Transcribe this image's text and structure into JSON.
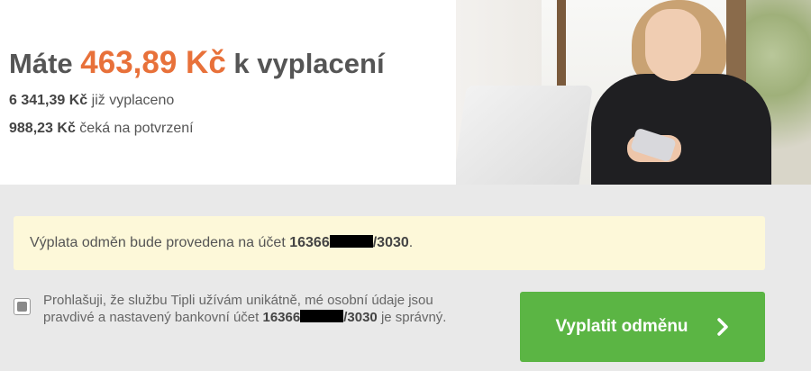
{
  "header": {
    "prefix": "Máte",
    "amount": "463,89 Kč",
    "suffix": "k vyplacení",
    "amount_color": "#e8713a"
  },
  "stats": [
    {
      "value": "6 341,39 Kč",
      "label": "již vyplaceno"
    },
    {
      "value": "988,23 Kč",
      "label": "čeká na potvrzení"
    }
  ],
  "notice": {
    "text": "Výplata odměn bude provedena na účet",
    "account_prefix": "16366",
    "account_suffix": "/3030",
    "end": ".",
    "background": "#fdf8d9"
  },
  "consent": {
    "text_before": "Prohlašuji, že službu Tipli užívám unikátně, mé osobní údaje jsou pravdivé a nastavený bankovní účet",
    "account_prefix": "16366",
    "account_suffix": "/3030",
    "text_after": "je správný.",
    "checked": true
  },
  "cta": {
    "label": "Vyplatit odměnu",
    "icon": "chevron-right-icon",
    "color": "#5bb544"
  },
  "hero_image": {
    "icon": "woman-with-laptop-photo"
  }
}
